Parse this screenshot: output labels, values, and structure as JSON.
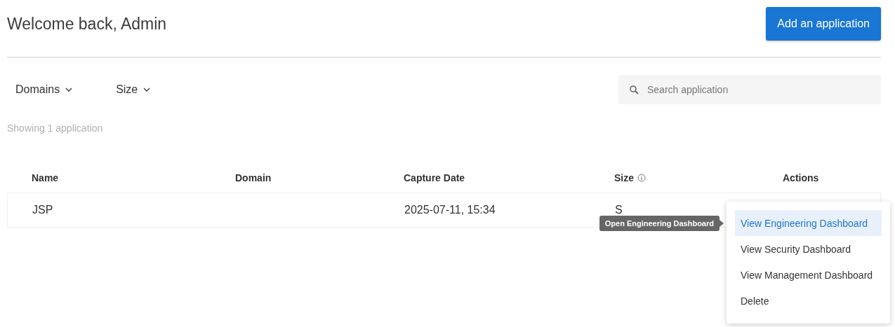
{
  "header": {
    "title": "Welcome back, Admin",
    "add_button": "Add an application"
  },
  "filters": [
    {
      "label": "Domains"
    },
    {
      "label": "Size"
    }
  ],
  "search": {
    "placeholder": "Search application"
  },
  "result_count": "Showing 1 application",
  "table": {
    "columns": [
      {
        "label": "Name",
        "info": false
      },
      {
        "label": "Domain",
        "info": false
      },
      {
        "label": "Capture Date",
        "info": false
      },
      {
        "label": "Size",
        "info": true
      },
      {
        "label": "Actions",
        "info": false
      }
    ],
    "rows": [
      {
        "name": "JSP",
        "domain": "",
        "capture_date": "2025-07-11, 15:34",
        "size": "S"
      }
    ]
  },
  "tooltip": "Open Engineering Dashboard",
  "actions_menu": [
    {
      "label": "View Engineering Dashboard",
      "selected": true
    },
    {
      "label": "View Security Dashboard",
      "selected": false
    },
    {
      "label": "View Management Dashboard",
      "selected": false
    },
    {
      "label": "Delete",
      "selected": false
    }
  ]
}
